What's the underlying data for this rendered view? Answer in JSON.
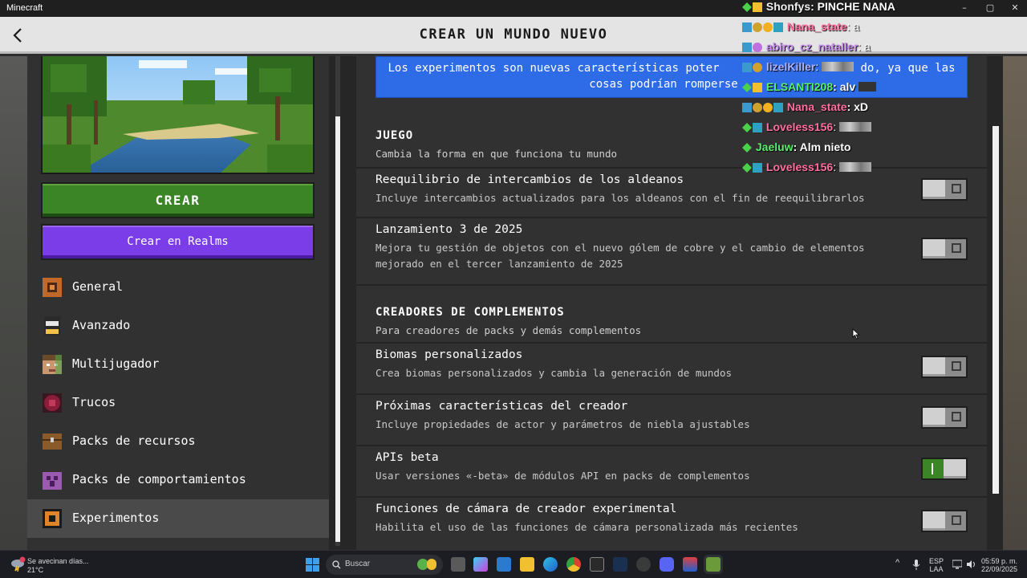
{
  "window": {
    "title": "Minecraft",
    "minimize": "–",
    "maximize": "▢",
    "close": "✕"
  },
  "header": {
    "title": "CREAR UN MUNDO NUEVO"
  },
  "left": {
    "create_label": "CREAR",
    "realms_label": "Crear en Realms",
    "nav": [
      {
        "label": "General",
        "icon": "gear-icon"
      },
      {
        "label": "Avanzado",
        "icon": "villager-icon"
      },
      {
        "label": "Multijugador",
        "icon": "player-face-icon"
      },
      {
        "label": "Trucos",
        "icon": "cheats-icon"
      },
      {
        "label": "Packs de recursos",
        "icon": "chest-icon"
      },
      {
        "label": "Packs de comportamientos",
        "icon": "creeper-icon"
      },
      {
        "label": "Experimentos",
        "icon": "experiments-icon"
      }
    ],
    "active": "Experimentos"
  },
  "banner": {
    "line1": "Los experimentos son nuevas características poter",
    "line1_end": "do, ya que las",
    "line2": "cosas podrían romperse"
  },
  "sections": {
    "juego": {
      "title": "JUEGO",
      "subtitle": "Cambia la forma en que funciona tu mundo"
    },
    "creadores": {
      "title": "CREADORES DE COMPLEMENTOS",
      "subtitle": "Para creadores de packs y demás complementos"
    }
  },
  "settings": [
    {
      "title": "Reequilibrio de intercambios de los aldeanos",
      "desc": "Incluye intercambios actualizados para los aldeanos con el fin de reequilibrarlos",
      "enabled": false
    },
    {
      "title": "Lanzamiento 3 de 2025",
      "desc": "Mejora tu gestión de objetos con el nuevo gólem de cobre y el cambio de elementos mejorado en el tercer lanzamiento de 2025",
      "enabled": false
    },
    {
      "title": "Biomas personalizados",
      "desc": "Crea biomas personalizados y cambia la generación de mundos",
      "enabled": false
    },
    {
      "title": "Próximas características del creador",
      "desc": "Incluye propiedades de actor y parámetros de niebla ajustables",
      "enabled": false
    },
    {
      "title": "APIs beta",
      "desc": "Usar versiones «-beta» de módulos API en packs de complementos",
      "enabled": true
    },
    {
      "title": "Funciones de cámara de creador experimental",
      "desc": "Habilita el uso de las funciones de cámara personalizada más recientes",
      "enabled": false
    }
  ],
  "chat": [
    {
      "name": "Shonfys",
      "msg": ": PINCHE NANA",
      "color": "#f0f0f0"
    },
    {
      "name": "Nana_state",
      "msg": ": a",
      "color": "#ff6fa0"
    },
    {
      "name": "abiro_cz_nataller",
      "msg": ": a",
      "color": "#c98cf0"
    },
    {
      "name": "lizelKiller",
      "msg": ":",
      "color": "#b0b0ff"
    },
    {
      "name": "ELSANTI208",
      "msg": ": alv",
      "color": "#58f06a"
    },
    {
      "name": "Nana_state",
      "msg": ": xD",
      "color": "#ff6fa0"
    },
    {
      "name": "Loveless156",
      "msg": ":",
      "color": "#ff6fa0"
    },
    {
      "name": "Jaeluw",
      "msg": ": Alm nieto",
      "color": "#58f06a"
    },
    {
      "name": "Loveless156",
      "msg": ":",
      "color": "#ff6fa0"
    }
  ],
  "taskbar": {
    "weather_line1": "Se avecinan días...",
    "weather_line2": "21°C",
    "search_label": "Buscar",
    "lang_line1": "ESP",
    "lang_line2": "LAA",
    "time": "05:59 p. m.",
    "date": "22/09/2025"
  }
}
